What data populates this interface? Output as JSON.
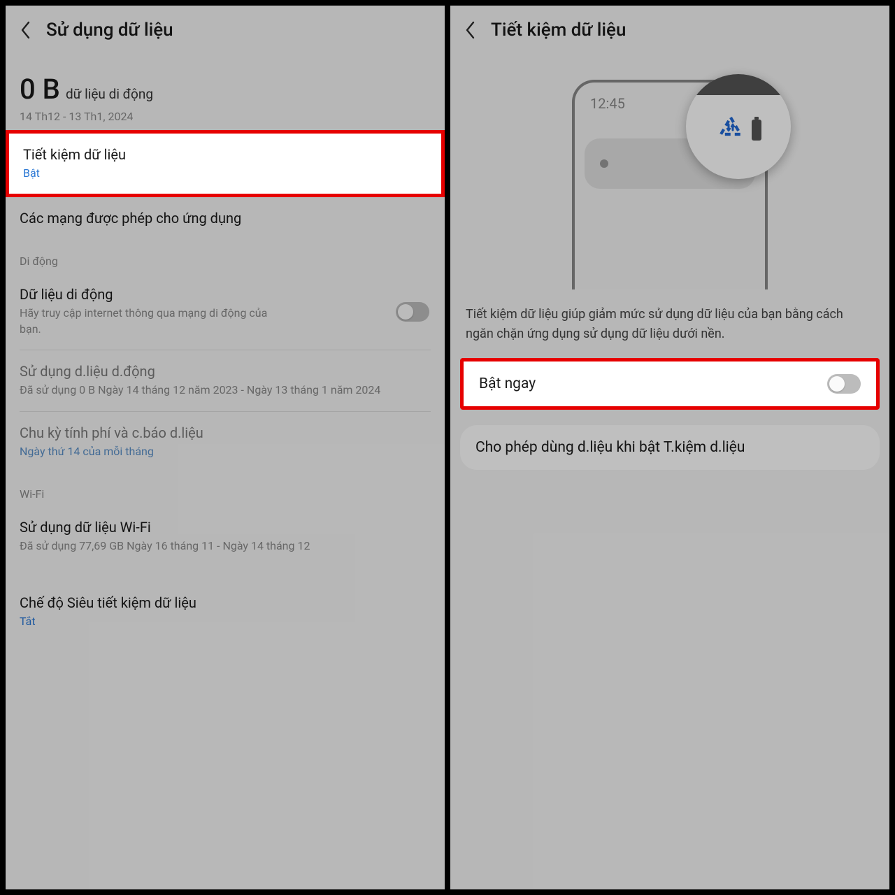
{
  "left": {
    "header": {
      "title": "Sử dụng dữ liệu"
    },
    "summary": {
      "amount": "0 B",
      "label": "dữ liệu di động",
      "date_range": "14 Th12 - 13 Th1, 2024"
    },
    "data_saver": {
      "title": "Tiết kiệm dữ liệu",
      "status": "Bật"
    },
    "allowed_networks": {
      "title": "Các mạng được phép cho ứng dụng"
    },
    "section_mobile": "Di động",
    "mobile_data": {
      "title": "Dữ liệu di động",
      "sub": "Hãy truy cập internet thông qua mạng di động của bạn."
    },
    "mobile_usage": {
      "title": "Sử dụng d.liệu d.động",
      "sub": "Đã sử dụng 0 B Ngày 14 tháng 12 năm 2023 - Ngày 13 tháng 1 năm 2024"
    },
    "billing": {
      "title": "Chu kỳ tính phí và c.báo d.liệu",
      "sub": "Ngày thứ 14 của mỗi tháng"
    },
    "section_wifi": "Wi-Fi",
    "wifi_usage": {
      "title": "Sử dụng dữ liệu Wi-Fi",
      "sub": "Đã sử dụng 77,69 GB Ngày 16 tháng 11 - Ngày 14 tháng 12"
    },
    "ultra_saver": {
      "title": "Chế độ Siêu tiết kiệm dữ liệu",
      "status": "Tắt"
    }
  },
  "right": {
    "header": {
      "title": "Tiết kiệm dữ liệu"
    },
    "illustration_time": "12:45",
    "description": "Tiết kiệm dữ liệu giúp giảm mức sử dụng dữ liệu của bạn bằng cách ngăn chặn ứng dụng sử dụng dữ liệu dưới nền.",
    "turn_on_now": "Bật ngay",
    "allow_data": "Cho phép dùng d.liệu khi bật T.kiệm d.liệu"
  }
}
